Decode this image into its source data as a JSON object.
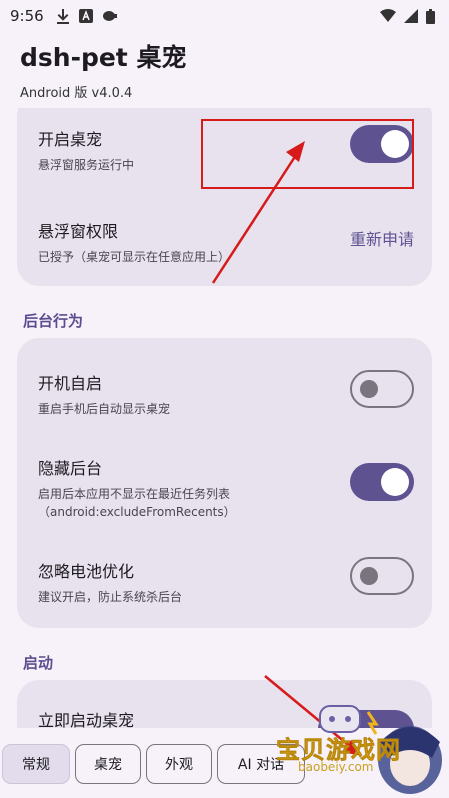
{
  "status_bar": {
    "time": "9:56",
    "icons": [
      "download-icon",
      "a-icon",
      "cast-icon"
    ],
    "right_icons": [
      "wifi-icon",
      "signal-icon",
      "battery-icon"
    ]
  },
  "header": {
    "title": "dsh-pet 桌宠",
    "subtitle": "Android 版 v4.0.4"
  },
  "card_main": {
    "rows": [
      {
        "title": "开启桌宠",
        "desc": "悬浮窗服务运行中",
        "switch_on": true
      },
      {
        "title": "悬浮窗权限",
        "desc": "已授予（桌宠可显示在任意应用上）",
        "action": "重新申请"
      }
    ]
  },
  "section_background": {
    "title": "后台行为",
    "rows": [
      {
        "title": "开机自启",
        "desc": "重启手机后自动显示桌宠",
        "switch_on": false
      },
      {
        "title": "隐藏后台",
        "desc": "启用后本应用不显示在最近任务列表（android:excludeFromRecents）",
        "switch_on": true
      },
      {
        "title": "忽略电池优化",
        "desc": "建议开启，防止系统杀后台",
        "switch_on": false
      }
    ]
  },
  "section_launch": {
    "title": "启动",
    "rows": [
      {
        "title": "立即启动桌宠"
      }
    ]
  },
  "tabs": [
    {
      "label": "常规",
      "active": true
    },
    {
      "label": "桌宠",
      "active": false
    },
    {
      "label": "外观",
      "active": false
    },
    {
      "label": "AI 对话",
      "active": false
    }
  ],
  "watermark": {
    "text": "宝贝游戏网",
    "url": "baobeiy.com"
  },
  "colors": {
    "accent": "#5e5390",
    "card_bg": "#e8e2ee",
    "page_bg": "#f7f2fa",
    "annotation_red": "#d71a1a"
  }
}
